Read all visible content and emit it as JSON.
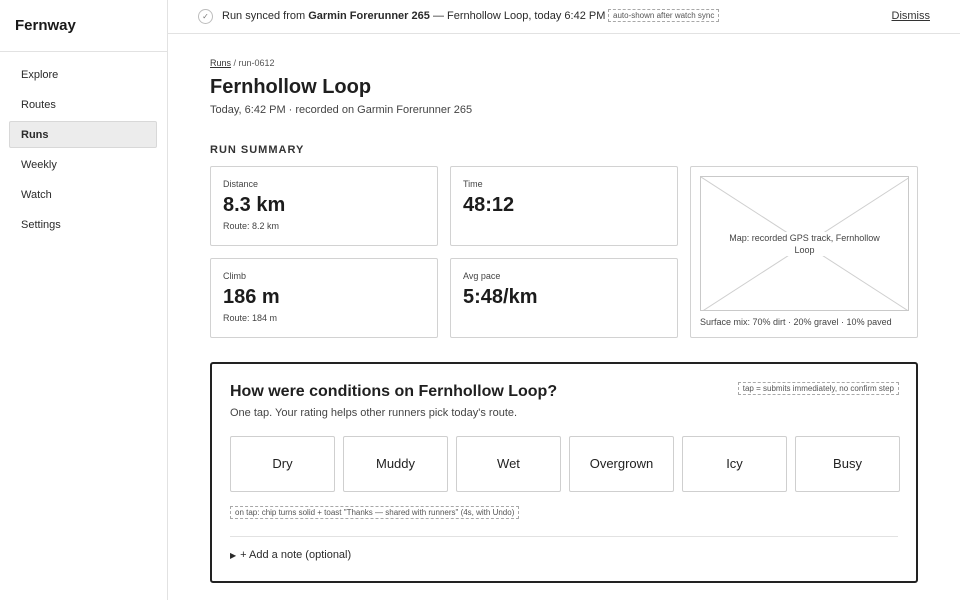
{
  "app": {
    "name": "Fernway"
  },
  "sidebar": {
    "items": [
      {
        "label": "Explore"
      },
      {
        "label": "Routes"
      },
      {
        "label": "Runs"
      },
      {
        "label": "Weekly"
      },
      {
        "label": "Watch"
      },
      {
        "label": "Settings"
      }
    ],
    "active_index": 2
  },
  "banner": {
    "check_icon": "✓",
    "prefix": "Run synced from",
    "device": "Garmin Forerunner 265",
    "suffix": "— Fernhollow Loop, today 6:42 PM",
    "note": "auto-shown after watch sync",
    "dismiss_label": "Dismiss"
  },
  "breadcrumb": {
    "parent": "Runs",
    "separator": " / ",
    "current": "run-0612"
  },
  "page": {
    "title": "Fernhollow Loop",
    "subtitle": "Today, 6:42 PM · recorded on Garmin Forerunner 265"
  },
  "summary": {
    "heading": "RUN SUMMARY",
    "distance": {
      "label": "Distance",
      "value": "8.3 km",
      "sub": "Route: 8.2 km"
    },
    "time": {
      "label": "Time",
      "value": "48:12"
    },
    "climb": {
      "label": "Climb",
      "value": "186 m",
      "sub": "Route: 184 m"
    },
    "pace": {
      "label": "Avg pace",
      "value": "5:48/km"
    },
    "map": {
      "caption": "Map: recorded GPS track, Fernhollow Loop",
      "surface": "Surface mix: 70% dirt · 20% gravel · 10% paved"
    }
  },
  "conditions": {
    "title": "How were conditions on Fernhollow Loop?",
    "subtitle": "One tap. Your rating helps other runners pick today's route.",
    "tap_note": "tap = submits immediately, no confirm step",
    "chips": [
      {
        "label": "Dry"
      },
      {
        "label": "Muddy"
      },
      {
        "label": "Wet"
      },
      {
        "label": "Overgrown"
      },
      {
        "label": "Icy"
      },
      {
        "label": "Busy"
      }
    ],
    "on_tap_note": "on tap: chip turns solid + toast \"Thanks — shared with runners\" (4s, with Undo)",
    "add_note_icon": "▶",
    "add_note_label": "+ Add a note (optional)"
  }
}
